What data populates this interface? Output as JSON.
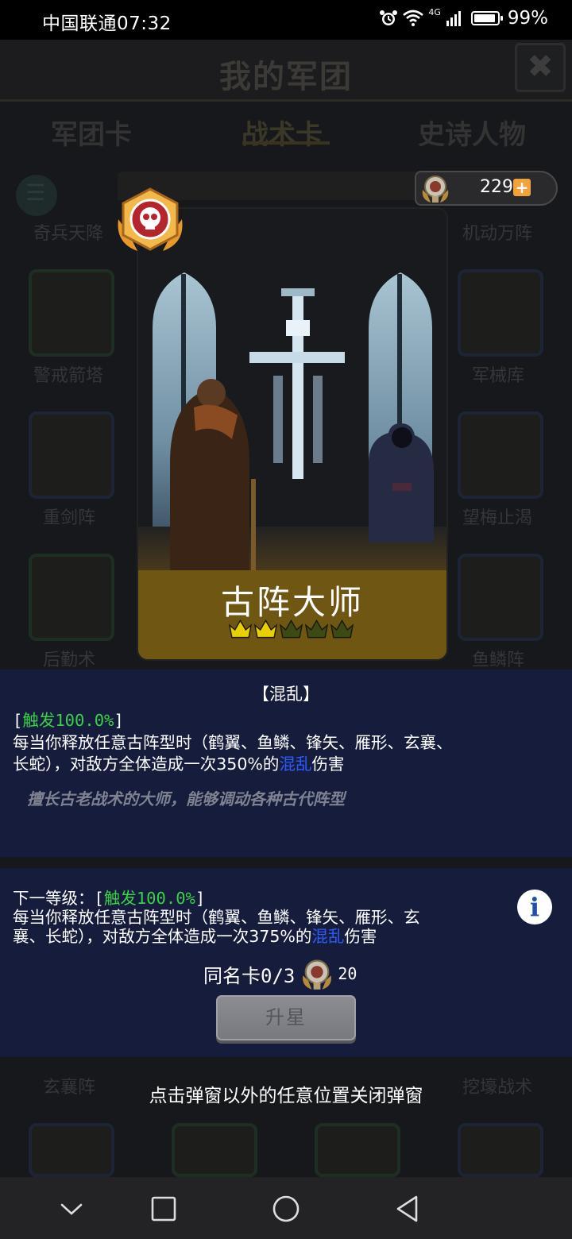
{
  "status_bar": {
    "carrier_time": "中国联通07:32",
    "network": "4G",
    "battery": "99%",
    "icons": [
      "alarm-icon",
      "wifi-icon",
      "signal-icon",
      "battery-icon"
    ]
  },
  "background": {
    "title": "我的军团",
    "tabs": [
      "军团卡",
      "战术卡",
      "史诗人物"
    ],
    "selected_tab": "战术卡",
    "grid_labels": {
      "r0_left": "奇兵天降",
      "r0_right": "机动万阵",
      "r1_left": "警戒箭塔",
      "r1_right": "军械库",
      "r2_left": "重剑阵",
      "r2_right": "望梅止渴",
      "r3_left": "后勤术",
      "r3_right": "鱼鳞阵",
      "r4_left": "玄襄阵",
      "r4_right": "挖壕战术"
    }
  },
  "card": {
    "name": "古阵大师",
    "stars_filled": 2,
    "stars_total": 5,
    "badge_icon": "skull-emblem-icon",
    "colors": {
      "name_band": "#6f5613",
      "crown_filled": "#e8d000",
      "crown_empty": "#3d4a14"
    }
  },
  "currency": {
    "value": "229",
    "plus_label": "+",
    "icon": "medal-icon"
  },
  "skill": {
    "title": "【混乱】",
    "current": {
      "prefix_open": "[",
      "trigger": "触发100.0%",
      "prefix_close": "]",
      "line2": "每当你释放任意古阵型时（鹤翼、鱼鳞、锋矢、雁形、玄襄、",
      "line3_a": "长蛇），对敌方全体造成一次350%的",
      "line3_effect": "混乱",
      "line3_b": "伤害"
    },
    "flavor": "擅长古老战术的大师，能够调动各种古代阵型",
    "next": {
      "label": "下一等级：[",
      "trigger": "触发100.0%",
      "close": "]",
      "line2": "每当你释放任意古阵型时（鹤翼、鱼鳞、锋矢、雁形、玄",
      "line3_a": "襄、长蛇），对敌方全体造成一次375%的",
      "line3_effect": "混乱",
      "line3_b": "伤害"
    },
    "colors": {
      "trigger": "#3bd04a",
      "effect": "#2f5bff"
    }
  },
  "upgrade": {
    "dupe_label": "同名卡0/3",
    "cost": "20",
    "button_label": "升星"
  },
  "hint": "点击弹窗以外的任意位置关闭弹窗",
  "nav": {
    "buttons": [
      "chevron-down-icon",
      "recent-apps-icon",
      "home-icon",
      "back-icon"
    ]
  }
}
